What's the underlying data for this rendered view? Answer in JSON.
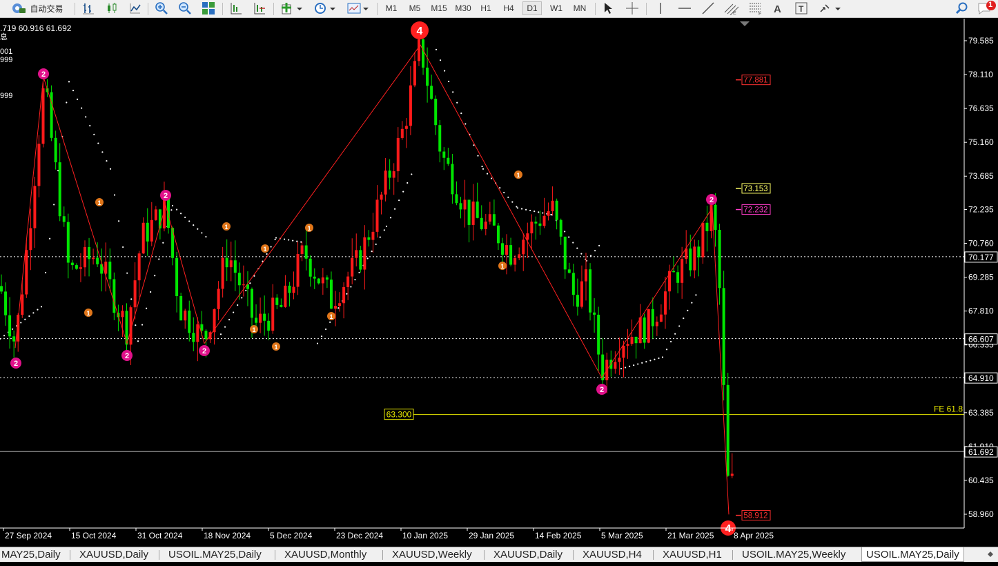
{
  "toolbar": {
    "autotrade_label": "自动交易",
    "timeframes": [
      "M1",
      "M5",
      "M15",
      "M30",
      "H1",
      "H4",
      "D1",
      "W1",
      "MN"
    ],
    "active_timeframe": "D1",
    "notification_count": "1"
  },
  "chart": {
    "info_line": ".719 60.916 61.692",
    "left_overlay": [
      "息",
      "001",
      "999",
      "",
      "999"
    ],
    "price_axis": {
      "ticks": [
        "79.585",
        "78.110",
        "76.635",
        "75.160",
        "73.685",
        "72.235",
        "70.760",
        "69.285",
        "67.810",
        "66.335",
        "64.910",
        "63.385",
        "61.910",
        "60.435",
        "58.960"
      ],
      "min": 58.96,
      "max": 79.585
    },
    "time_labels": [
      "27 Sep 2024",
      "15 Oct 2024",
      "31 Oct 2024",
      "18 Nov 2024",
      "5 Dec 2024",
      "23 Dec 2024",
      "10 Jan 2025",
      "29 Jan 2025",
      "14 Feb 2025",
      "5 Mar 2025",
      "21 Mar 2025",
      "8 Apr 2025"
    ],
    "horizontal_lines": [
      {
        "label": "70.177",
        "price": 70.177,
        "style": "dotted",
        "color": "#ffffff"
      },
      {
        "label": "66.607",
        "price": 66.607,
        "style": "dotted",
        "color": "#ffffff"
      },
      {
        "label": "64.910",
        "price": 64.91,
        "style": "dotted",
        "color": "#ffffff"
      },
      {
        "label": "61.692",
        "price": 61.692,
        "style": "solid",
        "color": "#c0c0c0"
      }
    ],
    "fe_line": {
      "price": 63.3,
      "label": "63.300",
      "right_text": "FE 61.8",
      "color": "#e6e600"
    },
    "marker_labels": [
      {
        "label": "77.881",
        "price": 77.881,
        "color": "#ff3030"
      },
      {
        "label": "73.153",
        "price": 73.153,
        "color": "#ffff66"
      },
      {
        "label": "72.232",
        "price": 72.232,
        "color": "#ff3cc8"
      },
      {
        "label": "58.912",
        "price": 58.912,
        "color": "#ff3030"
      }
    ],
    "colors": {
      "bull": "#00e600",
      "bear": "#ff1a1a",
      "sar": "#ffffff",
      "zigzag": "#ff2020",
      "label_major": "#ff2020",
      "label_mid": "#e0118a",
      "label_minor": "#e0761a"
    }
  },
  "wave_labels": [
    {
      "text": "4",
      "kind": "major"
    },
    {
      "text": "4",
      "kind": "major"
    },
    {
      "text": "2",
      "kind": "mid"
    },
    {
      "text": "2",
      "kind": "mid"
    },
    {
      "text": "2",
      "kind": "mid"
    },
    {
      "text": "2",
      "kind": "mid"
    },
    {
      "text": "2",
      "kind": "mid"
    },
    {
      "text": "2",
      "kind": "mid"
    },
    {
      "text": "2",
      "kind": "mid"
    },
    {
      "text": "1",
      "kind": "minor"
    },
    {
      "text": "1",
      "kind": "minor"
    },
    {
      "text": "1",
      "kind": "minor"
    },
    {
      "text": "1",
      "kind": "minor"
    },
    {
      "text": "1",
      "kind": "minor"
    },
    {
      "text": "1",
      "kind": "minor"
    },
    {
      "text": "1",
      "kind": "minor"
    },
    {
      "text": "1",
      "kind": "minor"
    },
    {
      "text": "1",
      "kind": "minor"
    },
    {
      "text": "1",
      "kind": "minor"
    }
  ],
  "tabs": [
    "MAY25,Daily",
    "XAUUSD,Daily",
    "USOIL.MAY25,Daily",
    "XAUUSD,Monthly",
    "XAUUSD,Weekly",
    "XAUUSD,Daily",
    "XAUUSD,H4",
    "XAUUSD,H1",
    "USOIL.MAY25,Weekly",
    "USOIL.MAY25,Daily"
  ],
  "active_tab": "USOIL.MAY25,Daily"
}
